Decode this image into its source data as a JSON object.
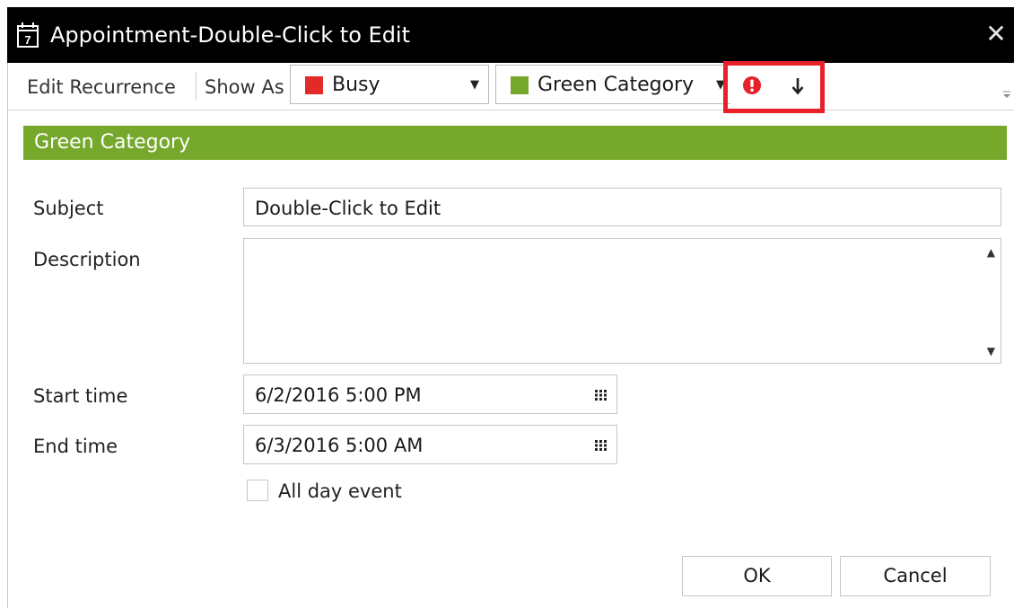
{
  "window": {
    "title": "Appointment-Double-Click to Edit",
    "icon": "calendar-icon",
    "close_glyph": "✕"
  },
  "toolbar": {
    "edit_recurrence_label": "Edit Recurrence",
    "show_as_label": "Show As",
    "show_as": {
      "value": "Busy",
      "color": "#e32a2a"
    },
    "category": {
      "value": "Green Category",
      "color": "#76a82c"
    },
    "importance_icon": "high-importance-icon",
    "low_icon": "low-importance-arrow-icon",
    "highlight_color": "#e8202a"
  },
  "category_banner": {
    "text": "Green Category",
    "color": "#76a82c"
  },
  "form": {
    "subject_label": "Subject",
    "subject_value": "Double-Click to Edit",
    "description_label": "Description",
    "description_value": "",
    "start_label": "Start time",
    "start_value": "6/2/2016 5:00 PM",
    "end_label": "End time",
    "end_value": "6/3/2016 5:00 AM",
    "all_day_label": "All day event",
    "all_day_checked": false
  },
  "buttons": {
    "ok": "OK",
    "cancel": "Cancel"
  }
}
